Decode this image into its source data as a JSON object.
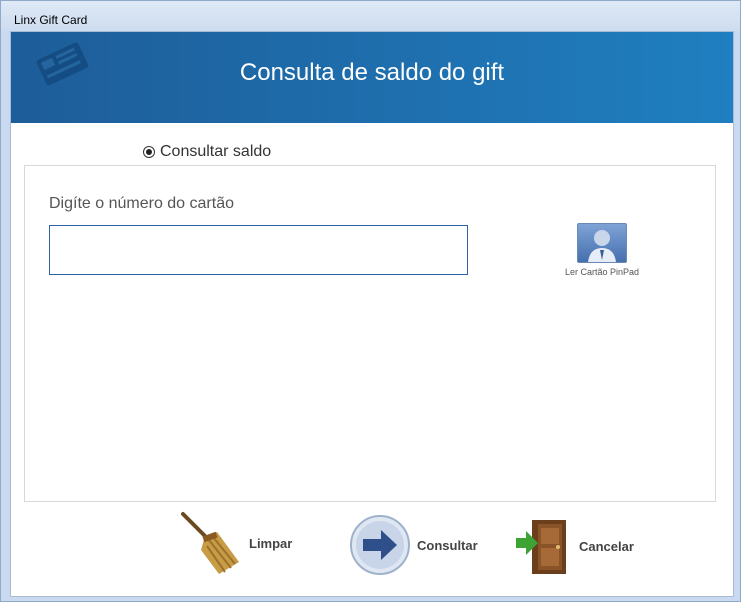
{
  "window": {
    "title": "Linx Gift Card"
  },
  "header": {
    "title": "Consulta de saldo do gift"
  },
  "radio": {
    "label": "Consultar saldo",
    "selected": true
  },
  "form": {
    "card_label": "Digíte o número do cartão",
    "card_value": "",
    "card_placeholder": ""
  },
  "pinpad": {
    "caption": "Ler Cartão PinPad",
    "icon": "card-reader-user-icon"
  },
  "buttons": {
    "clear": {
      "label": "Limpar",
      "icon": "broom-icon"
    },
    "query": {
      "label": "Consultar",
      "icon": "arrow-right-icon"
    },
    "cancel": {
      "label": "Cancelar",
      "icon": "exit-door-icon"
    }
  },
  "colors": {
    "header_start": "#1d5d99",
    "header_end": "#1f7fc0",
    "input_border": "#2f63a8"
  }
}
